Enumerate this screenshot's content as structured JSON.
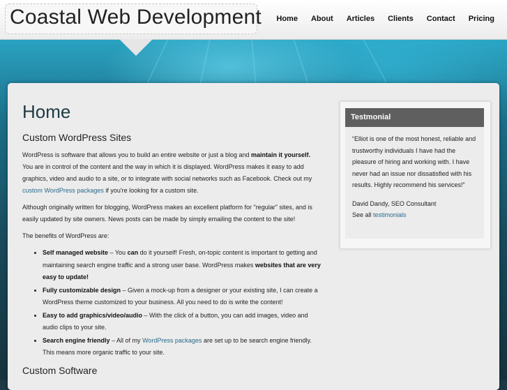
{
  "site": {
    "logo": "Coastal Web Development"
  },
  "nav": [
    "Home",
    "About",
    "Articles",
    "Clients",
    "Contact",
    "Pricing"
  ],
  "main": {
    "title": "Home",
    "section1": {
      "heading": "Custom WordPress Sites",
      "p1_a": "WordPress is software that allows you to build an entire website or just a blog and ",
      "p1_b": "maintain it yourself.",
      "p1_c": " You are in control of the content and the way in which it is displayed. WordPress makes it easy to add graphics, video and audio to a site, or to integrate with social networks such as Facebook. Check out my ",
      "p1_link": "custom WordPress packages",
      "p1_d": " if you're looking for a custom site.",
      "p2": "Although originally written for blogging, WordPress makes an excellent platform for \"regular\" sites, and is easily updated by site owners. News posts can be made by simply emailing the content to the site!",
      "p3": "The benefits of WordPress are:"
    },
    "benefits": [
      {
        "title": "Self managed website",
        "t1": " – You ",
        "bold2": "can",
        "t2": " do it yourself! Fresh, on-topic content is important to getting and maintaining search engine traffic and a strong user base. WordPress makes ",
        "bold3": "websites that are very easy to update!"
      },
      {
        "title": "Fully customizable design",
        "text": " – Given a mock-up from a designer or your existing site, I can create a WordPress theme customized to your business. All you need to do is write the content!"
      },
      {
        "title": "Easy to add graphics/video/audio",
        "text": " – With the click of a button, you can add images, video and audio clips to your site."
      },
      {
        "title": "Search engine friendly",
        "t1": " – All of my ",
        "link": "WordPress packages",
        "t2": " are set up to be search engine friendly. This means more organic traffic to your site."
      }
    ],
    "section2": {
      "heading": "Custom Software"
    }
  },
  "sidebar": {
    "widget_title": "Testmonial",
    "quote": "“Elliot is one of the most honest, reliable and trustworthy individuals I have had the pleasure of hiring and working with. I have never had an issue nor dissatisfied with his results. Highly recommend his services!”",
    "author": "David Dandy, SEO Consultant",
    "see_all_prefix": "See all ",
    "see_all_link": "testimonials"
  },
  "colors": {
    "link": "#2a6a8a",
    "widget_header": "#5f5f5f",
    "title": "#1e3a44"
  }
}
